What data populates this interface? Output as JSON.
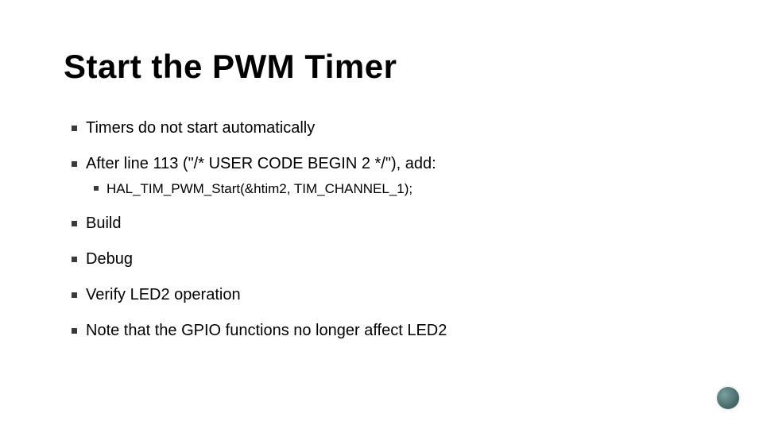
{
  "title": "Start the PWM Timer",
  "bullets": {
    "b0": "Timers do not start automatically",
    "b1": "After line 113 (\"/* USER CODE BEGIN 2 */\"), add:",
    "b1_sub0": "HAL_TIM_PWM_Start(&htim2, TIM_CHANNEL_1);",
    "b2": "Build",
    "b3": "Debug",
    "b4": "Verify LED2 operation",
    "b5": "Note that the GPIO functions no longer affect LED2"
  }
}
